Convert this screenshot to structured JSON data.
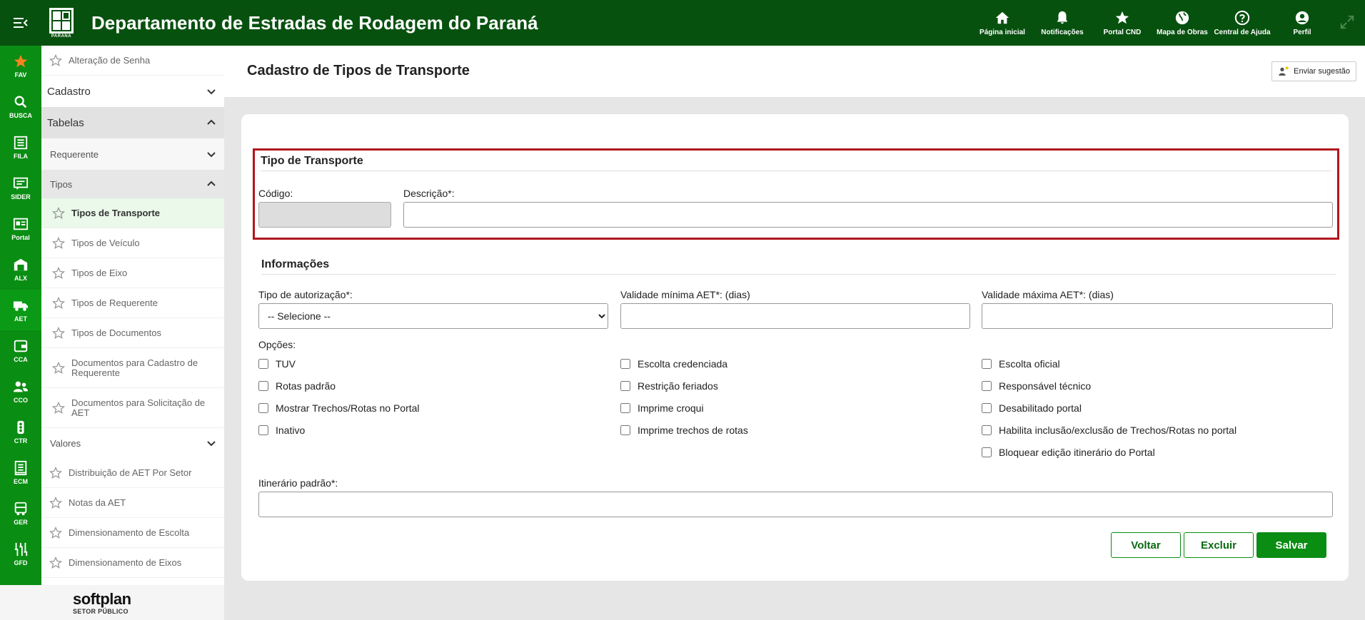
{
  "header": {
    "title": "Departamento de Estradas de Rodagem do Paraná",
    "logo_text": "PARANÁ",
    "nav": [
      {
        "label": "Página inicial",
        "icon": "home-icon"
      },
      {
        "label": "Notificações",
        "icon": "bell-icon"
      },
      {
        "label": "Portal CND",
        "icon": "star-icon"
      },
      {
        "label": "Mapa de Obras",
        "icon": "globe-icon"
      },
      {
        "label": "Central de Ajuda",
        "icon": "help-icon"
      },
      {
        "label": "Perfil",
        "icon": "user-icon"
      }
    ]
  },
  "rail": [
    {
      "label": "FAV",
      "icon": "star-icon"
    },
    {
      "label": "BUSCA",
      "icon": "search-icon"
    },
    {
      "label": "FILA",
      "icon": "list-icon"
    },
    {
      "label": "SIDER",
      "icon": "message-icon"
    },
    {
      "label": "Portal",
      "icon": "portal-icon"
    },
    {
      "label": "ALX",
      "icon": "warehouse-icon"
    },
    {
      "label": "AET",
      "icon": "truck-icon"
    },
    {
      "label": "CCA",
      "icon": "wallet-icon"
    },
    {
      "label": "CCO",
      "icon": "users-icon"
    },
    {
      "label": "CTR",
      "icon": "traffic-light-icon"
    },
    {
      "label": "ECM",
      "icon": "document-icon"
    },
    {
      "label": "GER",
      "icon": "bus-icon"
    },
    {
      "label": "GFD",
      "icon": "tools-icon"
    }
  ],
  "sidebar": {
    "item_senha": "Alteração de Senha",
    "cadastro": "Cadastro",
    "tabelas": "Tabelas",
    "requerente": "Requerente",
    "tipos": "Tipos",
    "tipos_items": [
      "Tipos de Transporte",
      "Tipos de Veículo",
      "Tipos de Eixo",
      "Tipos de Requerente",
      "Tipos de Documentos",
      "Documentos para Cadastro de Requerente",
      "Documentos para Solicitação de AET"
    ],
    "valores": "Valores",
    "valores_items": [
      "Distribuição de AET Por Setor",
      "Notas da AET",
      "Dimensionamento de Escolta",
      "Dimensionamento de Eixos"
    ]
  },
  "brand": {
    "name": "softplan",
    "sub": "SETOR PÚBLICO"
  },
  "page": {
    "title": "Cadastro de Tipos de Transporte",
    "suggest": "Enviar sugestão"
  },
  "form": {
    "section1": "Tipo de Transporte",
    "codigo_label": "Código:",
    "codigo_value": "",
    "descricao_label": "Descrição*:",
    "descricao_value": "",
    "section2": "Informações",
    "tipo_aut_label": "Tipo de autorização*:",
    "tipo_aut_value": "-- Selecione --",
    "val_min_label": "Validade mínima AET*: (dias)",
    "val_max_label": "Validade máxima AET*: (dias)",
    "opcoes_label": "Opções:",
    "opcoes_col1": [
      "TUV",
      "Rotas padrão",
      "Mostrar Trechos/Rotas no Portal",
      "Inativo"
    ],
    "opcoes_col2": [
      "Escolta credenciada",
      "Restrição feriados",
      "Imprime croqui",
      "Imprime trechos de rotas"
    ],
    "opcoes_col3": [
      "Escolta oficial",
      "Responsável técnico",
      "Desabilitado portal",
      "Habilita inclusão/exclusão de Trechos/Rotas no portal",
      "Bloquear edição itinerário do Portal"
    ],
    "itinerario_label": "Itinerário padrão*:",
    "btn_voltar": "Voltar",
    "btn_excluir": "Excluir",
    "btn_salvar": "Salvar"
  },
  "colors": {
    "header": "#07510f",
    "rail": "#0a8d13",
    "accent": "#0a8d13",
    "highlight_border": "#b0161d",
    "fav_star": "#f5821f"
  }
}
